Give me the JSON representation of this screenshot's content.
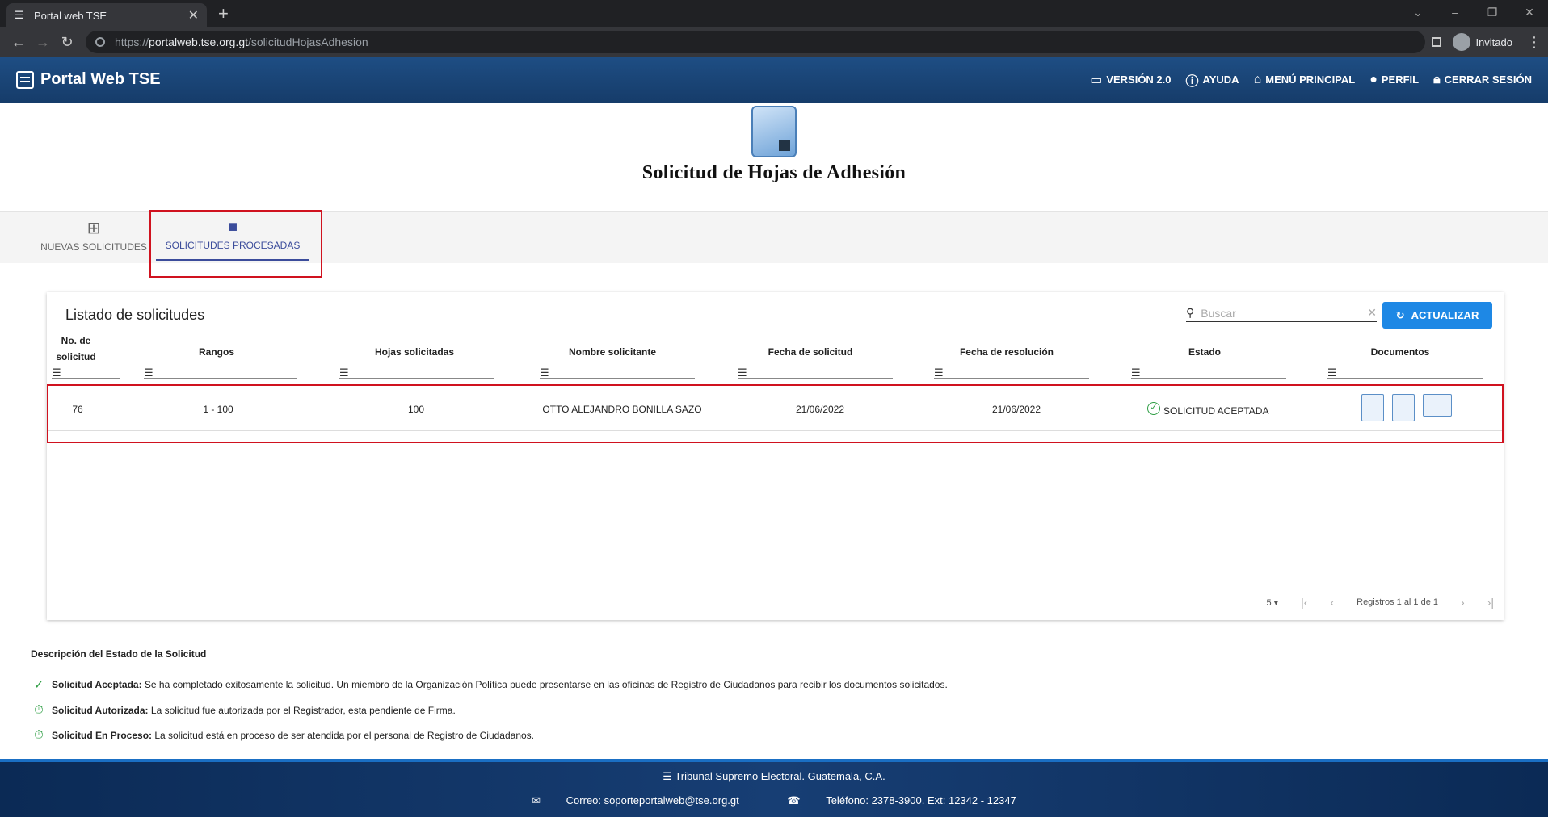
{
  "browser": {
    "tab_title": "Portal web TSE",
    "url_scheme": "https://",
    "url_host": "portalweb.tse.org.gt",
    "url_path": "/solicitudHojasAdhesion",
    "profile": "Invitado"
  },
  "header": {
    "brand": "Portal Web TSE",
    "menu": [
      {
        "label": "VERSIÓN 2.0",
        "icon": "laptop-icon"
      },
      {
        "label": "AYUDA",
        "icon": "help-icon"
      },
      {
        "label": "MENÚ PRINCIPAL",
        "icon": "home-icon"
      },
      {
        "label": "PERFIL",
        "icon": "account-icon"
      },
      {
        "label": "CERRAR SESIÓN",
        "icon": "lock-icon"
      }
    ]
  },
  "page": {
    "title": "Solicitud de Hojas de Adhesión",
    "tabs": [
      {
        "label": "NUEVAS SOLICITUDES",
        "icon": "library-add-icon"
      },
      {
        "label": "SOLICITUDES PROCESADAS",
        "icon": "folder-icon"
      }
    ]
  },
  "table": {
    "title": "Listado de solicitudes",
    "search_placeholder": "Buscar",
    "refresh_label": "ACTUALIZAR",
    "columns": [
      "No. de solicitud",
      "Rangos",
      "Hojas solicitadas",
      "Nombre solicitante",
      "Fecha de solicitud",
      "Fecha de resolución",
      "Estado",
      "Documentos"
    ],
    "rows": [
      {
        "no": "76",
        "rango": "1 - 100",
        "hojas": "100",
        "nombre": "OTTO ALEJANDRO BONILLA SAZO",
        "fecha_sol": "21/06/2022",
        "fecha_res": "21/06/2022",
        "estado": "SOLICITUD ACEPTADA"
      }
    ],
    "page_size": "5",
    "records": "Registros 1 al 1 de 1"
  },
  "legend": {
    "title": "Descripción del Estado de la Solicitud",
    "items": [
      {
        "name": "Solicitud Aceptada:",
        "desc": "Se ha completado exitosamente la solicitud. Un miembro de la Organización Política puede presentarse en las oficinas de Registro de Ciudadanos para recibir los documentos solicitados."
      },
      {
        "name": "Solicitud Autorizada:",
        "desc": "La solicitud fue autorizada por el Registrador, esta pendiente de Firma."
      },
      {
        "name": "Solicitud En Proceso:",
        "desc": "La solicitud está en proceso de ser atendida por el personal de Registro de Ciudadanos."
      }
    ]
  },
  "footer": {
    "org": "Tribunal Supremo Electoral. Guatemala, C.A.",
    "email": "Correo: soporteportalweb@tse.org.gt",
    "phone": "Teléfono: 2378-3900. Ext: 12342 - 12347"
  }
}
